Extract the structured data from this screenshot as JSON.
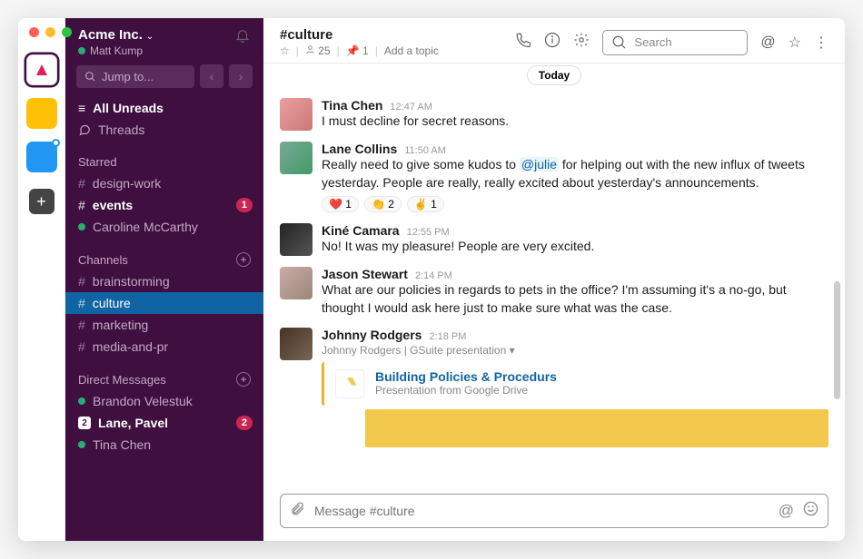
{
  "workspace": {
    "name": "Acme Inc.",
    "user": "Matt Kump"
  },
  "sidebar": {
    "jump": "Jump to...",
    "allunreads": "All Unreads",
    "threads": "Threads",
    "sections": {
      "starred": "Starred",
      "channels": "Channels",
      "dms": "Direct Messages"
    },
    "starred": [
      {
        "label": "design-work",
        "type": "channel"
      },
      {
        "label": "events",
        "type": "channel",
        "unread": true,
        "badge": "1"
      },
      {
        "label": "Caroline McCarthy",
        "type": "dm",
        "presence": "active"
      }
    ],
    "channels": [
      {
        "label": "brainstorming"
      },
      {
        "label": "culture",
        "active": true
      },
      {
        "label": "marketing"
      },
      {
        "label": "media-and-pr"
      }
    ],
    "dms": [
      {
        "label": "Brandon Velestuk",
        "presence": "active"
      },
      {
        "label": "Lane, Pavel",
        "unread": true,
        "badge": "2",
        "count": "2"
      },
      {
        "label": "Tina Chen",
        "presence": "active"
      }
    ]
  },
  "channel": {
    "name": "#culture",
    "members": "25",
    "pins": "1",
    "topic_prompt": "Add a topic",
    "search_placeholder": "Search",
    "divider": "Today"
  },
  "messages": [
    {
      "author": "Tina Chen",
      "time": "12:47 AM",
      "text": "I must decline for secret reasons.",
      "av": "av1"
    },
    {
      "author": "Lane Collins",
      "time": "11:50 AM",
      "pre": "Really need to give some kudos to ",
      "mention": "@julie",
      "post": " for helping out with the new influx of tweets yesterday. People are really, really excited about yesterday's announcements.",
      "av": "av2",
      "reactions": [
        {
          "e": "❤️",
          "c": "1"
        },
        {
          "e": "👏",
          "c": "2"
        },
        {
          "e": "✌️",
          "c": "1"
        }
      ]
    },
    {
      "author": "Kiné Camara",
      "time": "12:55 PM",
      "text": "No! It was my pleasure! People are very excited.",
      "av": "av3"
    },
    {
      "author": "Jason Stewart",
      "time": "2:14 PM",
      "text": "What are our policies in regards to pets in the office? I'm assuming it's a no-go, but thought I would ask here just to make sure what was the case.",
      "av": "av4"
    },
    {
      "author": "Johnny Rodgers",
      "time": "2:18 PM",
      "av": "av5",
      "attachment": {
        "label": "Johnny Rodgers | GSuite presentation",
        "title": "Building Policies & Procedurs",
        "sub": "Presentation from Google Drive"
      }
    }
  ],
  "composer": {
    "placeholder": "Message #culture"
  }
}
